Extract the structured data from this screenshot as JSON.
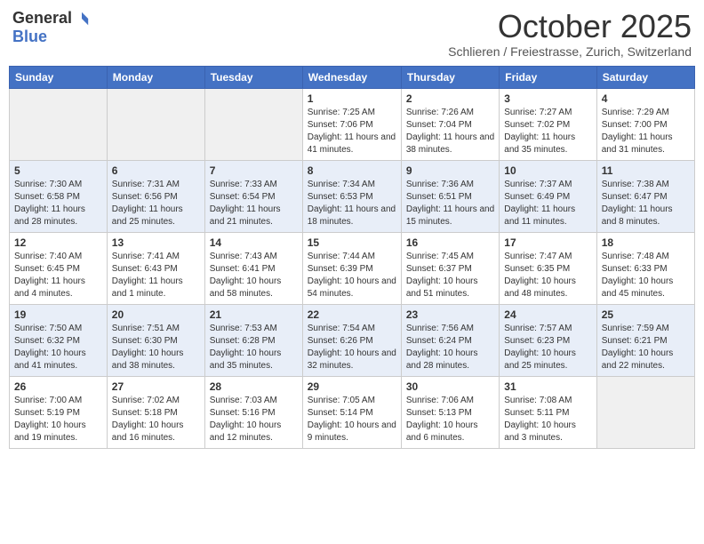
{
  "logo": {
    "general": "General",
    "blue": "Blue"
  },
  "title": "October 2025",
  "location": "Schlieren / Freiestrasse, Zurich, Switzerland",
  "days_of_week": [
    "Sunday",
    "Monday",
    "Tuesday",
    "Wednesday",
    "Thursday",
    "Friday",
    "Saturday"
  ],
  "weeks": [
    [
      {
        "day": "",
        "sunrise": "",
        "sunset": "",
        "daylight": "",
        "empty": true
      },
      {
        "day": "",
        "sunrise": "",
        "sunset": "",
        "daylight": "",
        "empty": true
      },
      {
        "day": "",
        "sunrise": "",
        "sunset": "",
        "daylight": "",
        "empty": true
      },
      {
        "day": "1",
        "sunrise": "Sunrise: 7:25 AM",
        "sunset": "Sunset: 7:06 PM",
        "daylight": "Daylight: 11 hours and 41 minutes."
      },
      {
        "day": "2",
        "sunrise": "Sunrise: 7:26 AM",
        "sunset": "Sunset: 7:04 PM",
        "daylight": "Daylight: 11 hours and 38 minutes."
      },
      {
        "day": "3",
        "sunrise": "Sunrise: 7:27 AM",
        "sunset": "Sunset: 7:02 PM",
        "daylight": "Daylight: 11 hours and 35 minutes."
      },
      {
        "day": "4",
        "sunrise": "Sunrise: 7:29 AM",
        "sunset": "Sunset: 7:00 PM",
        "daylight": "Daylight: 11 hours and 31 minutes."
      }
    ],
    [
      {
        "day": "5",
        "sunrise": "Sunrise: 7:30 AM",
        "sunset": "Sunset: 6:58 PM",
        "daylight": "Daylight: 11 hours and 28 minutes."
      },
      {
        "day": "6",
        "sunrise": "Sunrise: 7:31 AM",
        "sunset": "Sunset: 6:56 PM",
        "daylight": "Daylight: 11 hours and 25 minutes."
      },
      {
        "day": "7",
        "sunrise": "Sunrise: 7:33 AM",
        "sunset": "Sunset: 6:54 PM",
        "daylight": "Daylight: 11 hours and 21 minutes."
      },
      {
        "day": "8",
        "sunrise": "Sunrise: 7:34 AM",
        "sunset": "Sunset: 6:53 PM",
        "daylight": "Daylight: 11 hours and 18 minutes."
      },
      {
        "day": "9",
        "sunrise": "Sunrise: 7:36 AM",
        "sunset": "Sunset: 6:51 PM",
        "daylight": "Daylight: 11 hours and 15 minutes."
      },
      {
        "day": "10",
        "sunrise": "Sunrise: 7:37 AM",
        "sunset": "Sunset: 6:49 PM",
        "daylight": "Daylight: 11 hours and 11 minutes."
      },
      {
        "day": "11",
        "sunrise": "Sunrise: 7:38 AM",
        "sunset": "Sunset: 6:47 PM",
        "daylight": "Daylight: 11 hours and 8 minutes."
      }
    ],
    [
      {
        "day": "12",
        "sunrise": "Sunrise: 7:40 AM",
        "sunset": "Sunset: 6:45 PM",
        "daylight": "Daylight: 11 hours and 4 minutes."
      },
      {
        "day": "13",
        "sunrise": "Sunrise: 7:41 AM",
        "sunset": "Sunset: 6:43 PM",
        "daylight": "Daylight: 11 hours and 1 minute."
      },
      {
        "day": "14",
        "sunrise": "Sunrise: 7:43 AM",
        "sunset": "Sunset: 6:41 PM",
        "daylight": "Daylight: 10 hours and 58 minutes."
      },
      {
        "day": "15",
        "sunrise": "Sunrise: 7:44 AM",
        "sunset": "Sunset: 6:39 PM",
        "daylight": "Daylight: 10 hours and 54 minutes."
      },
      {
        "day": "16",
        "sunrise": "Sunrise: 7:45 AM",
        "sunset": "Sunset: 6:37 PM",
        "daylight": "Daylight: 10 hours and 51 minutes."
      },
      {
        "day": "17",
        "sunrise": "Sunrise: 7:47 AM",
        "sunset": "Sunset: 6:35 PM",
        "daylight": "Daylight: 10 hours and 48 minutes."
      },
      {
        "day": "18",
        "sunrise": "Sunrise: 7:48 AM",
        "sunset": "Sunset: 6:33 PM",
        "daylight": "Daylight: 10 hours and 45 minutes."
      }
    ],
    [
      {
        "day": "19",
        "sunrise": "Sunrise: 7:50 AM",
        "sunset": "Sunset: 6:32 PM",
        "daylight": "Daylight: 10 hours and 41 minutes."
      },
      {
        "day": "20",
        "sunrise": "Sunrise: 7:51 AM",
        "sunset": "Sunset: 6:30 PM",
        "daylight": "Daylight: 10 hours and 38 minutes."
      },
      {
        "day": "21",
        "sunrise": "Sunrise: 7:53 AM",
        "sunset": "Sunset: 6:28 PM",
        "daylight": "Daylight: 10 hours and 35 minutes."
      },
      {
        "day": "22",
        "sunrise": "Sunrise: 7:54 AM",
        "sunset": "Sunset: 6:26 PM",
        "daylight": "Daylight: 10 hours and 32 minutes."
      },
      {
        "day": "23",
        "sunrise": "Sunrise: 7:56 AM",
        "sunset": "Sunset: 6:24 PM",
        "daylight": "Daylight: 10 hours and 28 minutes."
      },
      {
        "day": "24",
        "sunrise": "Sunrise: 7:57 AM",
        "sunset": "Sunset: 6:23 PM",
        "daylight": "Daylight: 10 hours and 25 minutes."
      },
      {
        "day": "25",
        "sunrise": "Sunrise: 7:59 AM",
        "sunset": "Sunset: 6:21 PM",
        "daylight": "Daylight: 10 hours and 22 minutes."
      }
    ],
    [
      {
        "day": "26",
        "sunrise": "Sunrise: 7:00 AM",
        "sunset": "Sunset: 5:19 PM",
        "daylight": "Daylight: 10 hours and 19 minutes."
      },
      {
        "day": "27",
        "sunrise": "Sunrise: 7:02 AM",
        "sunset": "Sunset: 5:18 PM",
        "daylight": "Daylight: 10 hours and 16 minutes."
      },
      {
        "day": "28",
        "sunrise": "Sunrise: 7:03 AM",
        "sunset": "Sunset: 5:16 PM",
        "daylight": "Daylight: 10 hours and 12 minutes."
      },
      {
        "day": "29",
        "sunrise": "Sunrise: 7:05 AM",
        "sunset": "Sunset: 5:14 PM",
        "daylight": "Daylight: 10 hours and 9 minutes."
      },
      {
        "day": "30",
        "sunrise": "Sunrise: 7:06 AM",
        "sunset": "Sunset: 5:13 PM",
        "daylight": "Daylight: 10 hours and 6 minutes."
      },
      {
        "day": "31",
        "sunrise": "Sunrise: 7:08 AM",
        "sunset": "Sunset: 5:11 PM",
        "daylight": "Daylight: 10 hours and 3 minutes."
      },
      {
        "day": "",
        "sunrise": "",
        "sunset": "",
        "daylight": "",
        "empty": true
      }
    ]
  ]
}
